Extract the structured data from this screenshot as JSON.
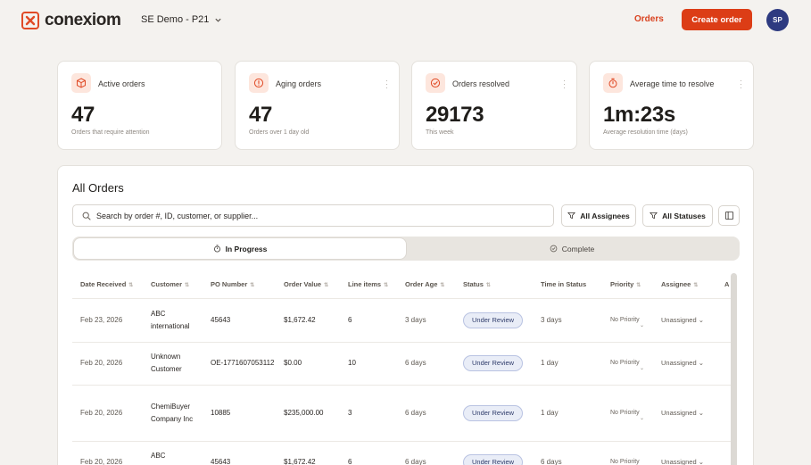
{
  "colors": {
    "accent": "#dc3d16",
    "avatar_bg": "#2d3a80",
    "background": "#f4f2ef"
  },
  "header": {
    "brand": "conexiom",
    "workspace": "SE Demo - P21",
    "nav_orders": "Orders",
    "create_order": "Create order",
    "avatar_initials": "SP"
  },
  "stats": [
    {
      "icon": "box-icon",
      "title": "Active orders",
      "value": "47",
      "subtitle": "Orders that require attention"
    },
    {
      "icon": "alert-circle-icon",
      "title": "Aging orders",
      "value": "47",
      "subtitle": "Orders over 1 day old"
    },
    {
      "icon": "check-circle-icon",
      "title": "Orders resolved",
      "value": "29173",
      "subtitle": "This week"
    },
    {
      "icon": "stopwatch-icon",
      "title": "Average time to resolve",
      "value": "1m:23s",
      "subtitle": "Average resolution time (days)"
    }
  ],
  "orders": {
    "title": "All Orders",
    "search_placeholder": "Search by order #, ID, customer, or supplier...",
    "filter_assignees": "All Assignees",
    "filter_statuses": "All Statuses",
    "tabs": [
      {
        "label": "In Progress"
      },
      {
        "label": "Complete"
      }
    ],
    "columns": [
      "Date Received",
      "Customer",
      "PO Number",
      "Order Value",
      "Line items",
      "Order Age",
      "Status",
      "Time in Status",
      "Priority",
      "Assignee",
      "A"
    ],
    "rows": [
      {
        "date": "Feb 23, 2026",
        "customer": "ABC international",
        "po": "45643",
        "value": "$1,672.42",
        "lines": "6",
        "age": "3 days",
        "status": "Under Review",
        "time_in_status": "3 days",
        "priority": "No Priority",
        "assignee": "Unassigned"
      },
      {
        "date": "Feb 20, 2026",
        "customer": "Unknown Customer",
        "po": "OE-1771607053112",
        "value": "$0.00",
        "lines": "10",
        "age": "6 days",
        "status": "Under Review",
        "time_in_status": "1 day",
        "priority": "No Priority",
        "assignee": "Unassigned"
      },
      {
        "date": "Feb 20, 2026",
        "customer": "ChemiBuyer Company Inc",
        "po": "10885",
        "value": "$235,000.00",
        "lines": "3",
        "age": "6 days",
        "status": "Under Review",
        "time_in_status": "1 day",
        "priority": "No Priority",
        "assignee": "Unassigned"
      },
      {
        "date": "Feb 20, 2026",
        "customer": "ABC international",
        "po": "45643",
        "value": "$1,672.42",
        "lines": "6",
        "age": "6 days",
        "status": "Under Review",
        "time_in_status": "6 days",
        "priority": "No Priority",
        "assignee": "Unassigned"
      }
    ]
  }
}
